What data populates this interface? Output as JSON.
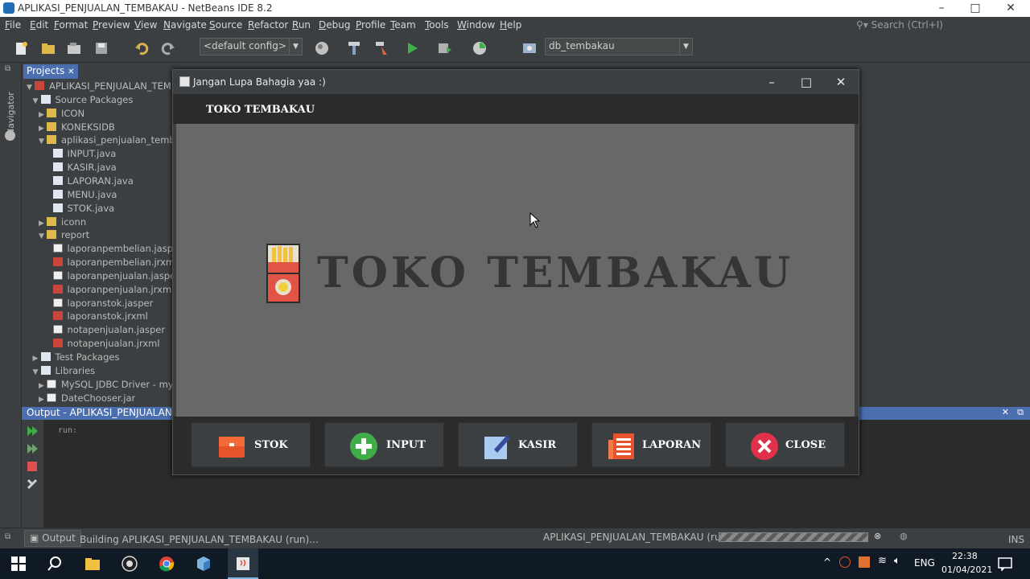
{
  "window": {
    "title": "APLIKASI_PENJUALAN_TEMBAKAU - NetBeans IDE 8.2",
    "min": "–",
    "max": "□",
    "close": "✕"
  },
  "menu": [
    "File",
    "Edit",
    "Format",
    "Preview",
    "View",
    "Navigate",
    "Source",
    "Refactor",
    "Run",
    "Debug",
    "Profile",
    "Team",
    "Tools",
    "Window",
    "Help"
  ],
  "search_placeholder": "Search (Ctrl+I)",
  "toolbar": {
    "config": "<default config>",
    "connection": "db_tembakau"
  },
  "navigator_label": "Navigator",
  "projects": {
    "tab": "Projects",
    "close": "✕",
    "nodes": [
      {
        "label": "APLIKASI_PENJUALAN_TEMBAKAU",
        "depth": 0,
        "toggle": "▼",
        "icon": "project"
      },
      {
        "label": "Source Packages",
        "depth": 1,
        "toggle": "▼",
        "icon": "source"
      },
      {
        "label": "ICON",
        "depth": 2,
        "toggle": "▶",
        "icon": "package"
      },
      {
        "label": "KONEKSIDB",
        "depth": 2,
        "toggle": "▶",
        "icon": "package"
      },
      {
        "label": "aplikasi_penjualan_tembakau",
        "depth": 2,
        "toggle": "▼",
        "icon": "package"
      },
      {
        "label": "INPUT.java",
        "depth": 3,
        "toggle": "",
        "icon": "java"
      },
      {
        "label": "KASIR.java",
        "depth": 3,
        "toggle": "",
        "icon": "java"
      },
      {
        "label": "LAPORAN.java",
        "depth": 3,
        "toggle": "",
        "icon": "java"
      },
      {
        "label": "MENU.java",
        "depth": 3,
        "toggle": "",
        "icon": "java"
      },
      {
        "label": "STOK.java",
        "depth": 3,
        "toggle": "",
        "icon": "java"
      },
      {
        "label": "iconn",
        "depth": 2,
        "toggle": "▶",
        "icon": "package"
      },
      {
        "label": "report",
        "depth": 2,
        "toggle": "▼",
        "icon": "package"
      },
      {
        "label": "laporanpembelian.jasper",
        "depth": 3,
        "toggle": "",
        "icon": "jasper"
      },
      {
        "label": "laporanpembelian.jrxml",
        "depth": 3,
        "toggle": "",
        "icon": "jrxml"
      },
      {
        "label": "laporanpenjualan.jasper",
        "depth": 3,
        "toggle": "",
        "icon": "jasper"
      },
      {
        "label": "laporanpenjualan.jrxml",
        "depth": 3,
        "toggle": "",
        "icon": "jrxml"
      },
      {
        "label": "laporanstok.jasper",
        "depth": 3,
        "toggle": "",
        "icon": "jasper"
      },
      {
        "label": "laporanstok.jrxml",
        "depth": 3,
        "toggle": "",
        "icon": "jrxml"
      },
      {
        "label": "notapenjualan.jasper",
        "depth": 3,
        "toggle": "",
        "icon": "jasper"
      },
      {
        "label": "notapenjualan.jrxml",
        "depth": 3,
        "toggle": "",
        "icon": "jrxml"
      },
      {
        "label": "Test Packages",
        "depth": 1,
        "toggle": "▶",
        "icon": "source"
      },
      {
        "label": "Libraries",
        "depth": 1,
        "toggle": "▼",
        "icon": "library"
      },
      {
        "label": "MySQL JDBC Driver - mysql-connector",
        "depth": 2,
        "toggle": "▶",
        "icon": "jar"
      },
      {
        "label": "DateChooser.jar",
        "depth": 2,
        "toggle": "▶",
        "icon": "jar"
      }
    ]
  },
  "output": {
    "title": "Output - APLIKASI_PENJUALAN_TEMBAKAU (run)",
    "text": "run:"
  },
  "status": {
    "output_tab": "Output",
    "building": "Building APLIKASI_PENJUALAN_TEMBAKAU (run)...",
    "running": "APLIKASI_PENJUALAN_TEMBAKAU (run)",
    "mode": "INS"
  },
  "dialog": {
    "title": "Jangan Lupa Bahagia yaa :)",
    "header": "TOKO TEMBAKAU",
    "big_title": "TOKO TEMBAKAU",
    "buttons": [
      "STOK",
      "INPUT",
      "KASIR",
      "LAPORAN",
      "CLOSE"
    ]
  },
  "taskbar": {
    "lang": "ENG",
    "time": "22:38",
    "date": "01/04/2021"
  },
  "colors": {
    "ide_bg": "#3c3f41",
    "selection_blue": "#4b6eaf",
    "dialog_content": "#686868",
    "stok": "#e8542a",
    "input": "#3fae49",
    "kasir": "#8fb8e8",
    "laporan": "#e8542a",
    "close": "#e0304a"
  }
}
